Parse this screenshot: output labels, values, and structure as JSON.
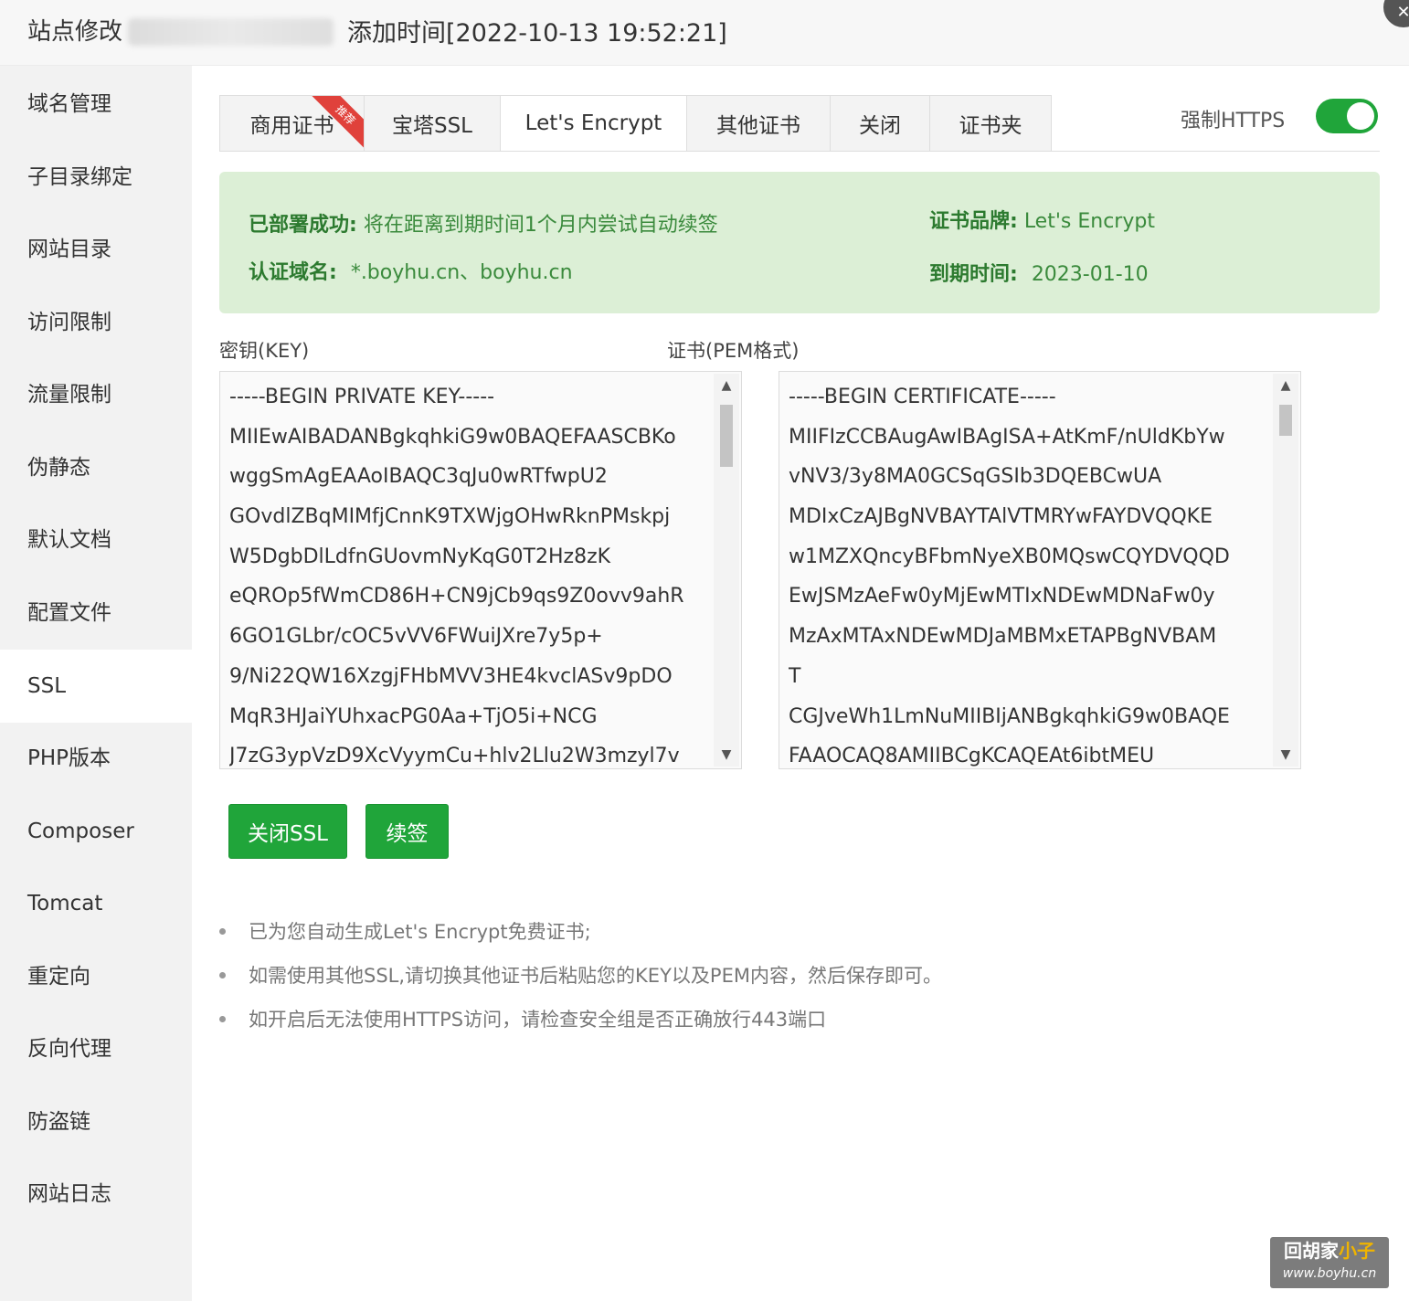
{
  "window": {
    "title": "站点修改",
    "added_time": "添加时间[2022-10-13 19:52:21]"
  },
  "sidebar": {
    "items": [
      {
        "label": "域名管理"
      },
      {
        "label": "子目录绑定"
      },
      {
        "label": "网站目录"
      },
      {
        "label": "访问限制"
      },
      {
        "label": "流量限制"
      },
      {
        "label": "伪静态"
      },
      {
        "label": "默认文档"
      },
      {
        "label": "配置文件"
      },
      {
        "label": "SSL",
        "active": true
      },
      {
        "label": "PHP版本"
      },
      {
        "label": "Composer"
      },
      {
        "label": "Tomcat"
      },
      {
        "label": "重定向"
      },
      {
        "label": "反向代理"
      },
      {
        "label": "防盗链"
      },
      {
        "label": "网站日志"
      }
    ]
  },
  "tabs": [
    {
      "label": "商用证书",
      "badge": "推荐"
    },
    {
      "label": "宝塔SSL"
    },
    {
      "label": "Let's Encrypt",
      "active": true
    },
    {
      "label": "其他证书"
    },
    {
      "label": "关闭"
    },
    {
      "label": "证书夹"
    }
  ],
  "force_https": {
    "label": "强制HTTPS",
    "enabled": true
  },
  "status": {
    "deployed_key": "已部署成功:",
    "deployed_value": "将在距离到期时间1个月内尝试自动续签",
    "domain_key": "认证域名:",
    "domain_value": "*.boyhu.cn、boyhu.cn",
    "brand_key": "证书品牌:",
    "brand_value": "Let's Encrypt",
    "expiry_key": "到期时间:",
    "expiry_value": "2023-01-10"
  },
  "key_field": {
    "label": "密钥(KEY)",
    "lines": [
      "-----BEGIN PRIVATE KEY-----",
      "MIIEwAIBADANBgkqhkiG9w0BAQEFAASCBKo",
      "wggSmAgEAAoIBAQC3qJu0wRTfwpU2",
      "GOvdlZBqMIMfjCnnK9TXWjgOHwRknPMskpj",
      "W5DgbDlLdfnGUovmNyKqG0T2Hz8zK",
      "eQROp5fWmCD86H+CN9jCb9qs9Z0ovv9ahR",
      "6GO1GLbr/cOC5vVV6FWuiJXre7y5p+",
      "9/Ni22QW16XzgjFHbMVV3HE4kvclASv9pDO",
      "MqR3HJaiYUhxacPG0Aa+TjO5i+NCG",
      "J7zG3ypVzD9XcVyymCu+hlv2Llu2W3mzyl7v"
    ]
  },
  "cert_field": {
    "label": "证书(PEM格式)",
    "lines": [
      "-----BEGIN CERTIFICATE-----",
      "MIIFIzCCBAugAwIBAgISA+AtKmF/nUldKbYw",
      "vNV3/3y8MA0GCSqGSIb3DQEBCwUA",
      "MDIxCzAJBgNVBAYTAlVTMRYwFAYDVQQKE",
      "w1MZXQncyBFbmNyeXB0MQswCQYDVQQD",
      "EwJSMzAeFw0yMjEwMTIxNDEwMDNaFw0y",
      "MzAxMTAxNDEwMDJaMBMxETAPBgNVBAM",
      "T",
      "CGJveWh1LmNuMIIBIjANBgkqhkiG9w0BAQE",
      "FAAOCAQ8AMIIBCgKCAQEAt6ibtMEU"
    ]
  },
  "buttons": {
    "close_ssl": "关闭SSL",
    "renew": "续签"
  },
  "tips": [
    "已为您自动生成Let's Encrypt免费证书;",
    "如需使用其他SSL,请切换其他证书后粘贴您的KEY以及PEM内容，然后保存即可。",
    "如开启后无法使用HTTPS访问，请检查安全组是否正确放行443端口"
  ],
  "watermark": {
    "line1_a": "回胡家",
    "line1_b": "小子",
    "line2": "www.boyhu.cn"
  },
  "colors": {
    "accent_green": "#20a53a",
    "success_bg": "#dcefd6",
    "badge_red": "#e0413b"
  }
}
